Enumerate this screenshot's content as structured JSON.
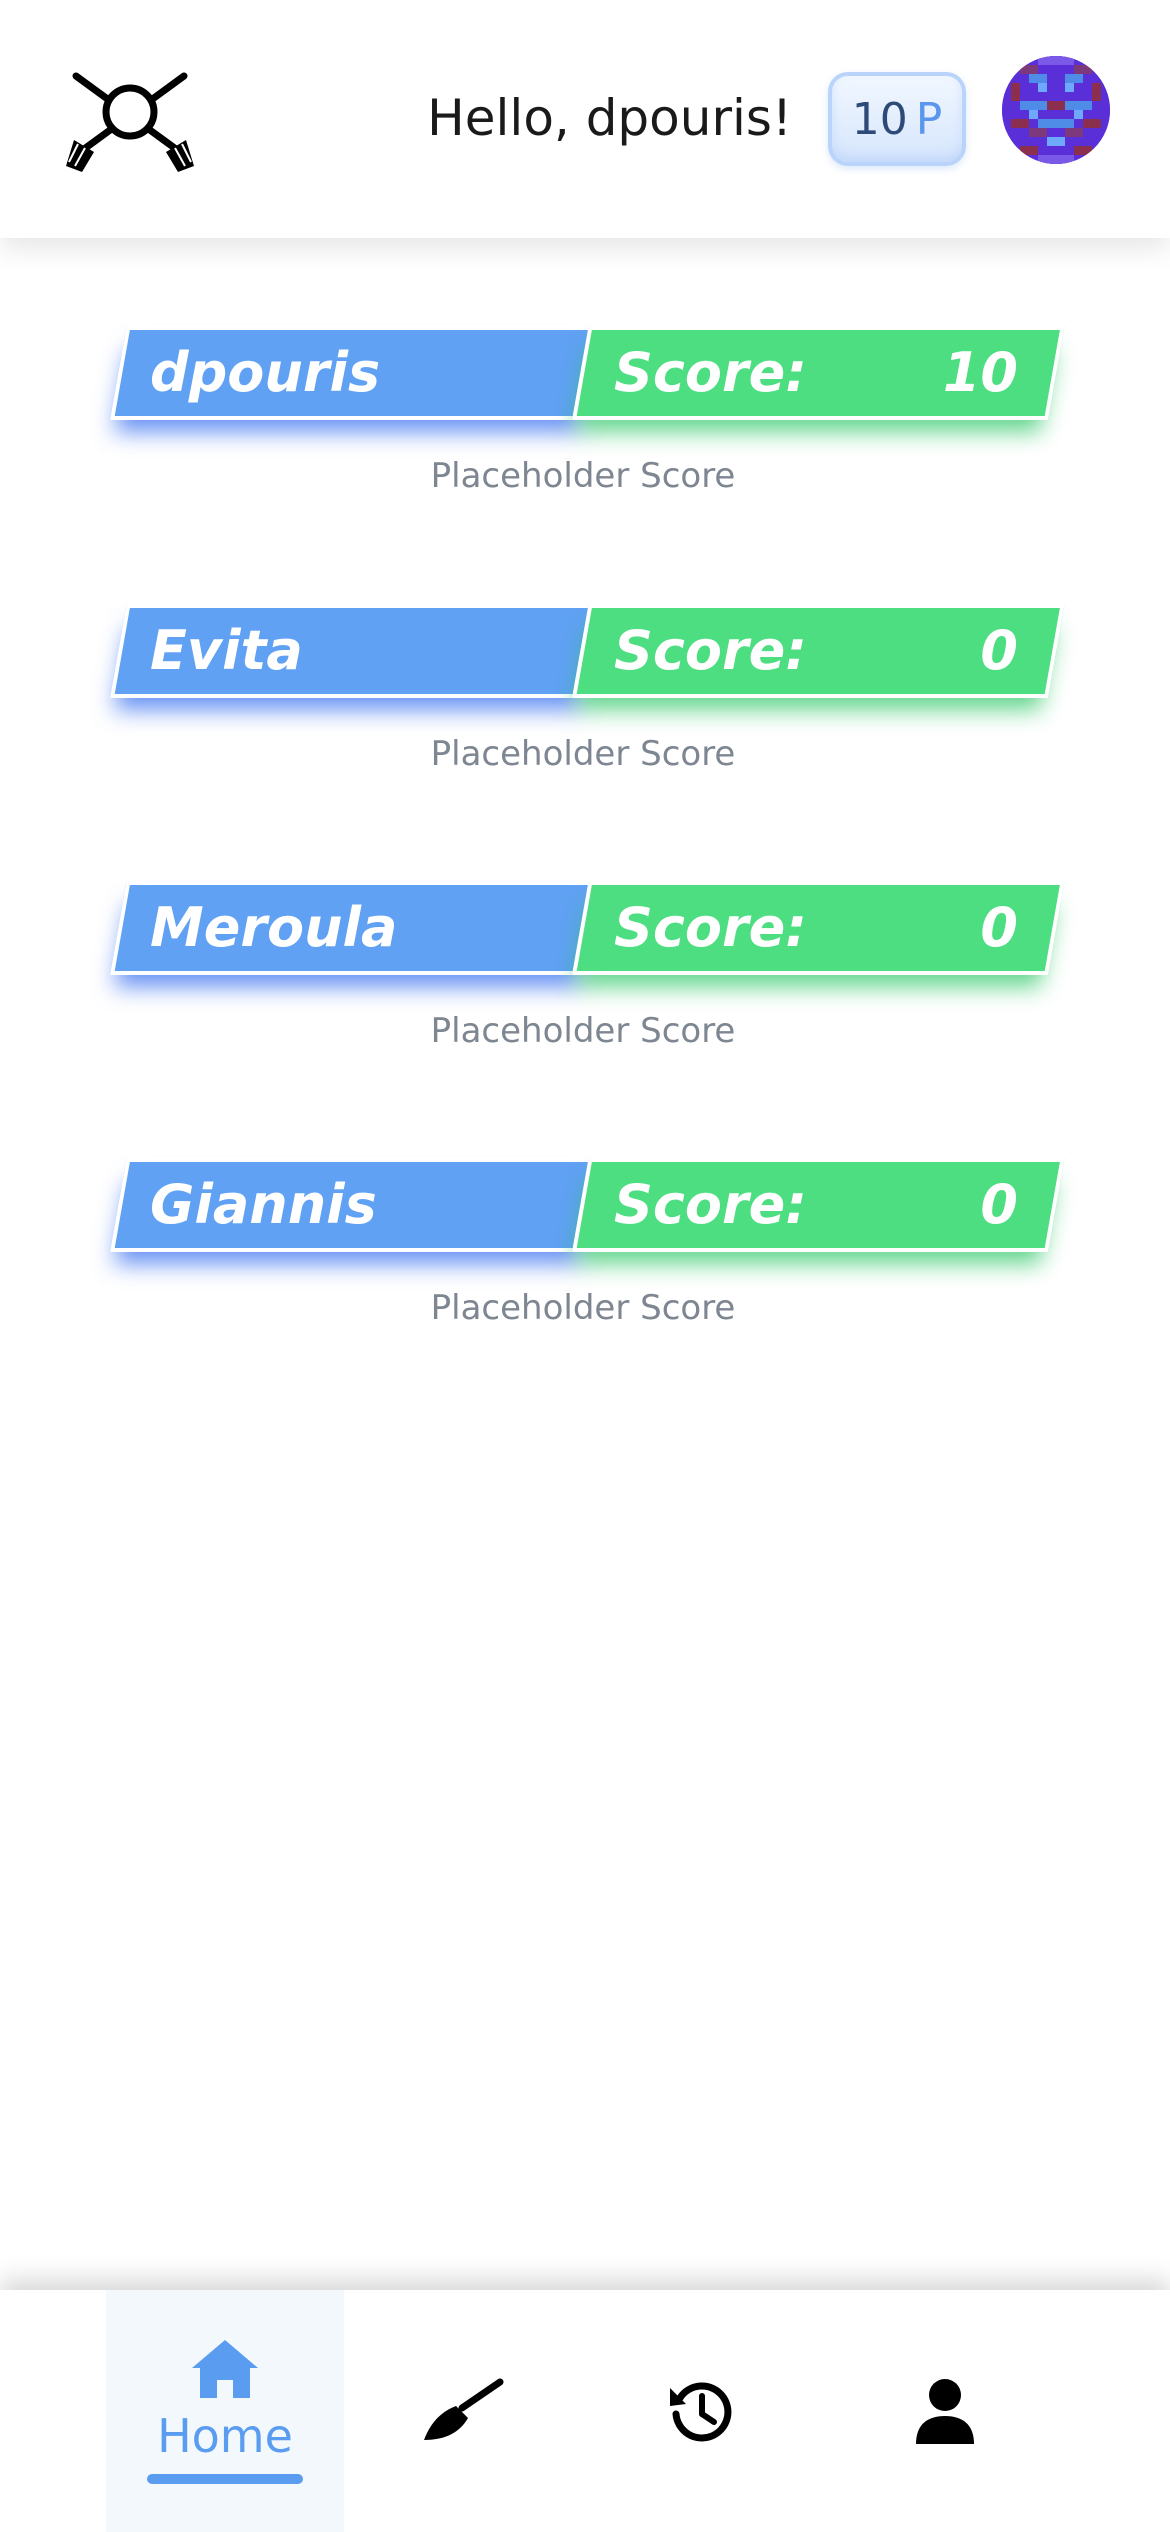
{
  "header": {
    "greeting": "Hello, dpouris!",
    "points_value": "10",
    "points_unit": "P",
    "logo_icon": "crossed-brooms-icon",
    "avatar_icon": "pixel-avatar"
  },
  "scores": [
    {
      "name": "dpouris",
      "score_label": "Score:",
      "score": "10",
      "caption": "Placeholder Score"
    },
    {
      "name": "Evita",
      "score_label": "Score:",
      "score": "0",
      "caption": "Placeholder Score"
    },
    {
      "name": "Meroula",
      "score_label": "Score:",
      "score": "0",
      "caption": "Placeholder Score"
    },
    {
      "name": "Giannis",
      "score_label": "Score:",
      "score": "0",
      "caption": "Placeholder Score"
    }
  ],
  "nav": {
    "home_label": "Home",
    "active": "Home",
    "items": [
      "home-icon",
      "broom-icon",
      "history-icon",
      "user-icon"
    ]
  },
  "colors": {
    "name_bar": "#60a1f3",
    "score_bar": "#4cde80",
    "accent": "#5a9cf0",
    "avatar_bg": "#5b2fd7"
  }
}
